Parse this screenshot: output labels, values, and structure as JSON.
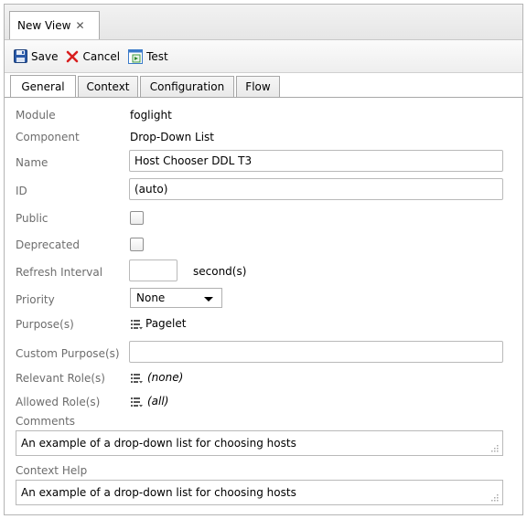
{
  "window": {
    "tab_title": "New View",
    "close_glyph": "✕"
  },
  "toolbar": {
    "save_label": "Save",
    "cancel_label": "Cancel",
    "test_label": "Test",
    "icons": {
      "save": "floppy-disk-icon",
      "cancel": "red-x-icon",
      "test": "test-page-icon"
    }
  },
  "tabs": [
    {
      "label": "General",
      "active": true
    },
    {
      "label": "Context",
      "active": false
    },
    {
      "label": "Configuration",
      "active": false
    },
    {
      "label": "Flow",
      "active": false
    }
  ],
  "form": {
    "module": {
      "label": "Module",
      "value": "foglight"
    },
    "component": {
      "label": "Component",
      "value": "Drop-Down List"
    },
    "name": {
      "label": "Name",
      "value": "Host Chooser DDL T3"
    },
    "id": {
      "label": "ID",
      "value": "(auto)"
    },
    "public": {
      "label": "Public",
      "checked": false
    },
    "deprecated": {
      "label": "Deprecated",
      "checked": false
    },
    "refresh_interval": {
      "label": "Refresh Interval",
      "value": "",
      "unit": "second(s)"
    },
    "priority": {
      "label": "Priority",
      "value": "None"
    },
    "purposes": {
      "label": "Purpose(s)",
      "value": "Pagelet"
    },
    "custom_purpose": {
      "label": "Custom Purpose(s)",
      "value": ""
    },
    "relevant_roles": {
      "label": "Relevant Role(s)",
      "value": "(none)"
    },
    "allowed_roles": {
      "label": "Allowed Role(s)",
      "value": "(all)"
    },
    "comments": {
      "label": "Comments",
      "value": "An example of a drop-down list for choosing hosts"
    },
    "context_help": {
      "label": "Context Help",
      "value": "An example of a drop-down list for choosing hosts"
    }
  },
  "colors": {
    "label_gray": "#6d6d6d",
    "border": "#b9b9b9",
    "cancel_red": "#d81e1e",
    "save_blue": "#2b5aa8"
  }
}
